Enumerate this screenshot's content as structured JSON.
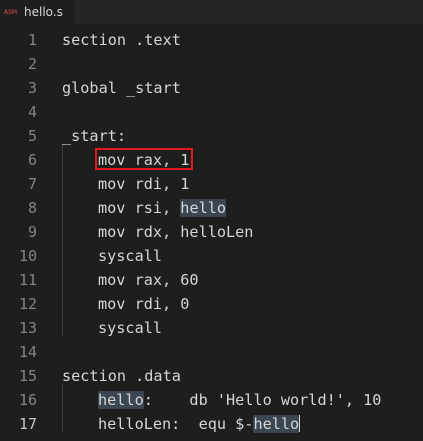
{
  "tab": {
    "icon_label": "ASM",
    "filename": "hello.s"
  },
  "lines": [
    {
      "number": "1",
      "text": "section .text"
    },
    {
      "number": "2",
      "text": ""
    },
    {
      "number": "3",
      "text": "global _start"
    },
    {
      "number": "4",
      "text": ""
    },
    {
      "number": "5",
      "text": "_start:"
    },
    {
      "number": "6",
      "text": "mov rax, 1"
    },
    {
      "number": "7",
      "text": "mov rdi, 1"
    },
    {
      "number": "8",
      "pre": "mov rsi, ",
      "hl": "hello",
      "post": ""
    },
    {
      "number": "9",
      "text": "mov rdx, helloLen"
    },
    {
      "number": "10",
      "text": "syscall"
    },
    {
      "number": "11",
      "text": "mov rax, 60"
    },
    {
      "number": "12",
      "text": "mov rdi, 0"
    },
    {
      "number": "13",
      "text": "syscall"
    },
    {
      "number": "14",
      "text": ""
    },
    {
      "number": "15",
      "text": "section .data"
    },
    {
      "number": "16",
      "pre": "",
      "hl": "hello",
      "post": ":    db 'Hello world!', 10"
    },
    {
      "number": "17",
      "pre": "helloLen:  equ $-",
      "hl": "hello",
      "post": ""
    }
  ],
  "colors": {
    "background": "#1e1e1e",
    "highlight": "#3b4653",
    "annotation_box": "#e01b1b"
  }
}
